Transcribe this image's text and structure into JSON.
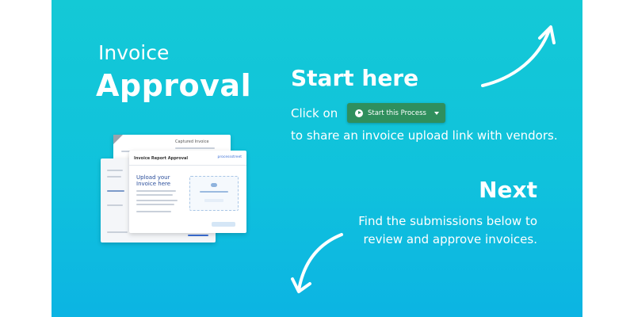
{
  "colors": {
    "background_top": "#14c9d6",
    "background_bottom": "#0cb4e3",
    "button_green": "#2f8f5d",
    "text": "#ffffff"
  },
  "header": {
    "title_line1": "Invoice",
    "title_line2": "Approval"
  },
  "start": {
    "heading": "Start here",
    "click_on": "Click on",
    "button_label": "Start this Process",
    "button_icon": "play-icon",
    "dropdown_icon": "caret-down-icon",
    "share_text": "to share an invoice upload link with vendors."
  },
  "next": {
    "heading": "Next",
    "line1": "Find the submissions below to",
    "line2": "review and approve invoices."
  },
  "preview": {
    "main_title": "Invoice Report Approval",
    "logo_text": "processstreet",
    "upload_title": "Upload your Invoice here",
    "back_title": "Captured Invoice"
  }
}
